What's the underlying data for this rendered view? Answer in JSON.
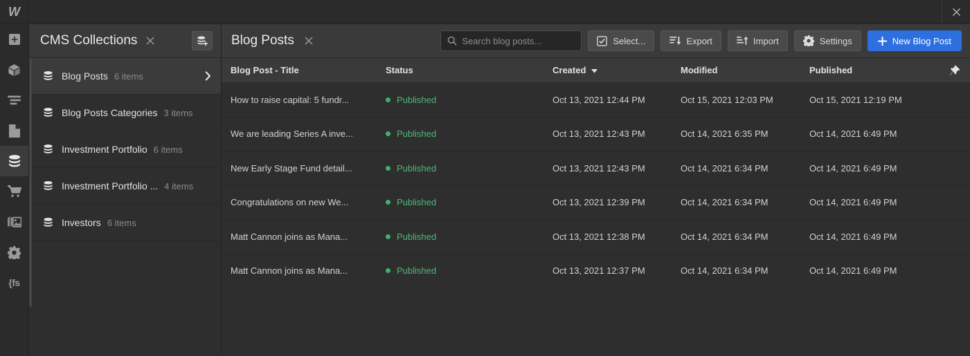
{
  "window": {
    "logo": "W",
    "close_icon": "close-icon"
  },
  "rail": {
    "items": [
      {
        "name": "add-panel",
        "icon": "plus-square-icon"
      },
      {
        "name": "elements-panel",
        "icon": "box-icon"
      },
      {
        "name": "navigator-panel",
        "icon": "navigator-icon"
      },
      {
        "name": "pages-panel",
        "icon": "page-icon"
      },
      {
        "name": "cms-panel",
        "icon": "database-icon",
        "active": true
      },
      {
        "name": "ecommerce-panel",
        "icon": "cart-icon"
      },
      {
        "name": "assets-panel",
        "icon": "media-icon"
      },
      {
        "name": "settings-panel",
        "icon": "gear-icon"
      },
      {
        "name": "code-panel",
        "icon": "fs-icon",
        "label": "{fs"
      }
    ]
  },
  "cms": {
    "title": "CMS Collections",
    "close_icon": "close-icon",
    "add_button_icon": "database-plus-icon",
    "collections": [
      {
        "name": "Blog Posts",
        "count": "6 items",
        "selected": true
      },
      {
        "name": "Blog Posts Categories",
        "count": "3 items",
        "selected": false
      },
      {
        "name": "Investment Portfolio",
        "count": "6 items",
        "selected": false
      },
      {
        "name": "Investment Portfolio ...",
        "count": "4 items",
        "selected": false
      },
      {
        "name": "Investors",
        "count": "6 items",
        "selected": false
      }
    ]
  },
  "main": {
    "title": "Blog Posts",
    "close_icon": "close-icon",
    "search": {
      "placeholder": "Search blog posts...",
      "value": "",
      "icon": "search-icon"
    },
    "buttons": [
      {
        "label": "Select...",
        "icon": "checkbox-icon",
        "primary": false
      },
      {
        "label": "Export",
        "icon": "export-icon",
        "primary": false
      },
      {
        "label": "Import",
        "icon": "import-icon",
        "primary": false
      },
      {
        "label": "Settings",
        "icon": "gear-icon",
        "primary": false
      },
      {
        "label": "New Blog Post",
        "icon": "plus-icon",
        "primary": true
      }
    ],
    "table": {
      "columns": {
        "title": "Blog Post - Title",
        "status": "Status",
        "created": "Created",
        "modified": "Modified",
        "published": "Published"
      },
      "sort": {
        "column": "Created",
        "direction": "desc",
        "icon": "caret-down-icon"
      },
      "pin_icon": "pin-icon",
      "rows": [
        {
          "title": "How to raise capital: 5 fundr...",
          "status": "Published",
          "created": "Oct 13, 2021 12:44 PM",
          "modified": "Oct 15, 2021 12:03 PM",
          "published": "Oct 15, 2021 12:19 PM"
        },
        {
          "title": "We are leading Series A inve...",
          "status": "Published",
          "created": "Oct 13, 2021 12:43 PM",
          "modified": "Oct 14, 2021 6:35 PM",
          "published": "Oct 14, 2021 6:49 PM"
        },
        {
          "title": "New Early Stage Fund detail...",
          "status": "Published",
          "created": "Oct 13, 2021 12:43 PM",
          "modified": "Oct 14, 2021 6:34 PM",
          "published": "Oct 14, 2021 6:49 PM"
        },
        {
          "title": "Congratulations on new We...",
          "status": "Published",
          "created": "Oct 13, 2021 12:39 PM",
          "modified": "Oct 14, 2021 6:34 PM",
          "published": "Oct 14, 2021 6:49 PM"
        },
        {
          "title": "Matt Cannon joins as Mana...",
          "status": "Published",
          "created": "Oct 13, 2021 12:38 PM",
          "modified": "Oct 14, 2021 6:34 PM",
          "published": "Oct 14, 2021 6:49 PM"
        },
        {
          "title": "Matt Cannon joins as Mana...",
          "status": "Published",
          "created": "Oct 13, 2021 12:37 PM",
          "modified": "Oct 14, 2021 6:34 PM",
          "published": "Oct 14, 2021 6:49 PM"
        }
      ]
    }
  },
  "colors": {
    "accent_blue": "#2e6fe0",
    "status_green": "#4fb878",
    "panel_bg": "#2e2e2e",
    "header_bg": "#3a3a3a"
  }
}
